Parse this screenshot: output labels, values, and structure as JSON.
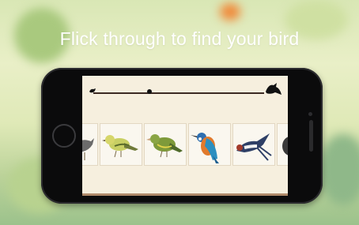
{
  "headline": "Flick through to find your bird",
  "slider": {
    "caption": ""
  },
  "birds": [
    {
      "name": ""
    },
    {
      "name": ""
    },
    {
      "name": ""
    },
    {
      "name": ""
    },
    {
      "name": ""
    },
    {
      "name": ""
    }
  ],
  "colors": {
    "background": "#dfe9b7",
    "screen": "#f6efde",
    "phone": "#0b0b0c"
  },
  "icons": {
    "slider_start": "small-bird-icon",
    "slider_end": "bird-silhouette-icon"
  }
}
